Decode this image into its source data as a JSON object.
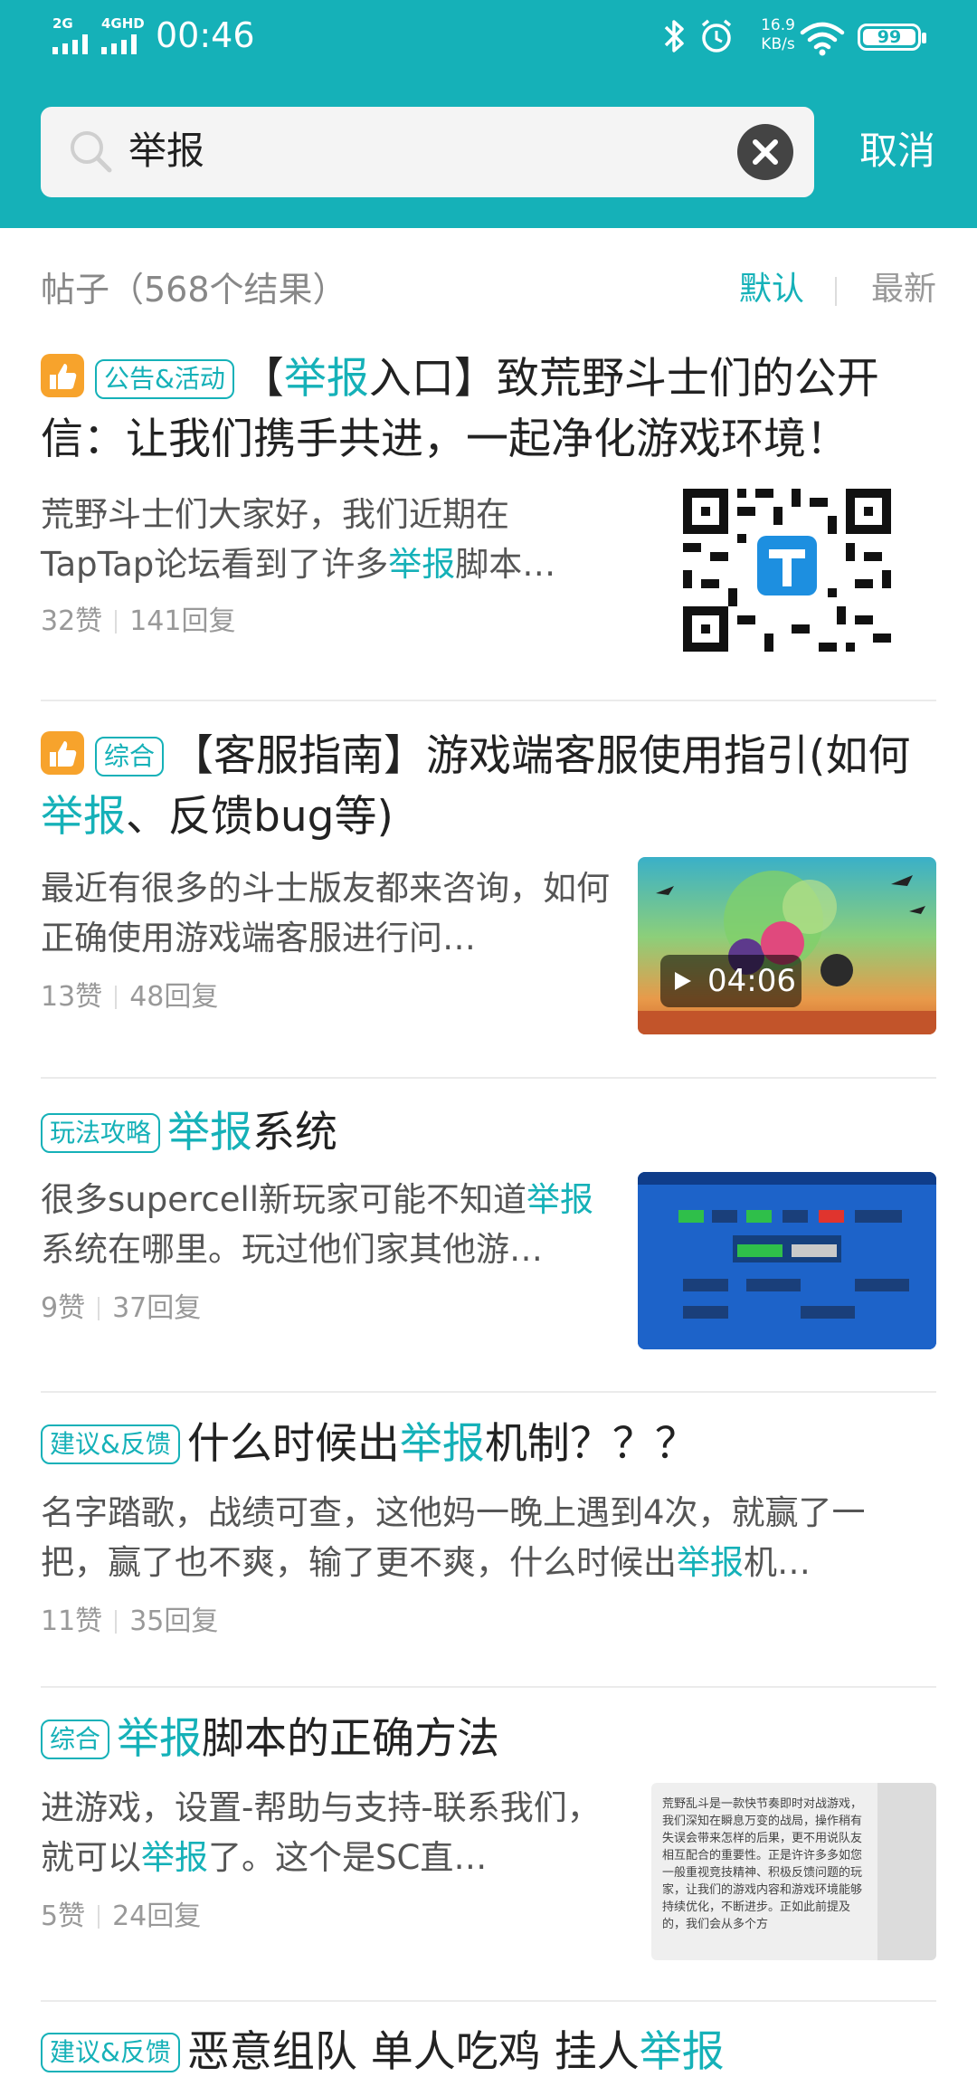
{
  "status_bar": {
    "network_1": "2G",
    "network_2": "4GHD",
    "time": "00:46",
    "speed_value": "16.9",
    "speed_unit": "KB/s",
    "battery": "99"
  },
  "search": {
    "query": "举报",
    "cancel_label": "取消"
  },
  "results": {
    "count_label": "帖子（568个结果）",
    "sort_default": "默认",
    "sort_latest": "最新"
  },
  "posts": [
    {
      "tag": "公告&活动",
      "title_pre": "【",
      "title_hl": "举报",
      "title_post": "入口】致荒野斗士们的公开信：让我们携手共进，一起净化游戏环境！",
      "excerpt_pre": "荒野斗士们大家好，我们近期在TapTap论坛看到了许多",
      "excerpt_hl": "举报",
      "excerpt_post": "脚本…",
      "likes": "32赞",
      "replies": "141回复"
    },
    {
      "tag": "综合",
      "title_pre": "【客服指南】游戏端客服使用指引(如何",
      "title_hl": "举报",
      "title_post": "、反馈bug等)",
      "excerpt": "最近有很多的斗士版友都来咨询，如何正确使用游戏端客服进行问…",
      "likes": "13赞",
      "replies": "48回复",
      "video_duration": "04:06"
    },
    {
      "tag": "玩法攻略",
      "title_hl": "举报",
      "title_post": "系统",
      "excerpt_pre": "很多supercell新玩家可能不知道",
      "excerpt_hl": "举报",
      "excerpt_post": "系统在哪里。玩过他们家其他游…",
      "likes": "9赞",
      "replies": "37回复"
    },
    {
      "tag": "建议&反馈",
      "title_pre": "什么时候出",
      "title_hl": "举报",
      "title_post": "机制？？？",
      "excerpt_pre": "名字踏歌，战绩可查，这他妈一晚上遇到4次，就赢了一把，赢了也不爽，输了更不爽，什么时候出",
      "excerpt_hl": "举报",
      "excerpt_post": "机…",
      "likes": "11赞",
      "replies": "35回复"
    },
    {
      "tag": "综合",
      "title_hl": "举报",
      "title_post": "脚本的正确方法",
      "excerpt_pre": "进游戏，设置-帮助与支持-联系我们，就可以",
      "excerpt_hl": "举报",
      "excerpt_post": "了。这个是SC直…",
      "likes": "5赞",
      "replies": "24回复",
      "thumb_text": "荒野乱斗是一款快节奏即时对战游戏，我们深知在瞬息万变的战局，操作稍有失误会带来怎样的后果，更不用说队友相互配合的重要性。正是许许多多如您一般重视竞技精神、积极反馈问题的玩家，让我们的游戏内容和游戏环境能够持续优化，不断进步。正如此前提及的，我们会从多个方"
    },
    {
      "tag": "建议&反馈",
      "title_pre": "恶意组队 单人吃鸡 挂人",
      "title_hl": "举报"
    }
  ]
}
